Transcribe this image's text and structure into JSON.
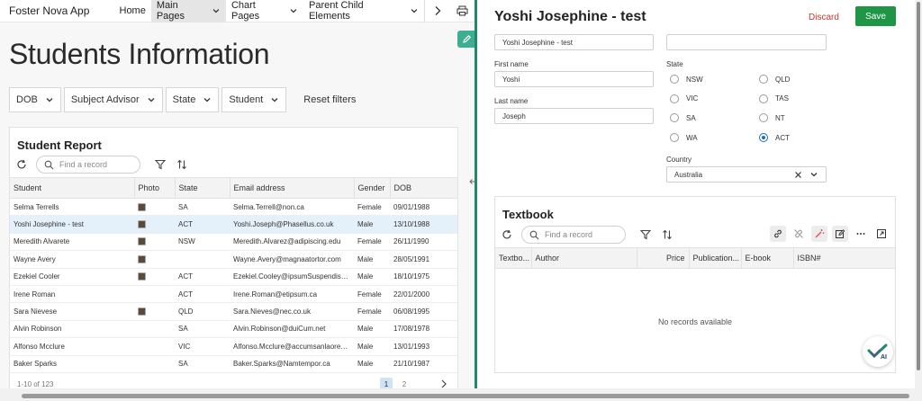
{
  "app": {
    "name": "Foster Nova App"
  },
  "nav": {
    "items": [
      {
        "label": "Home"
      },
      {
        "label": "Main Pages"
      },
      {
        "label": "Chart Pages"
      },
      {
        "label": "Parent Child Elements"
      }
    ]
  },
  "page": {
    "title": "Students Information"
  },
  "filters": {
    "items": [
      {
        "label": "DOB"
      },
      {
        "label": "Subject Advisor"
      },
      {
        "label": "State"
      },
      {
        "label": "Student"
      }
    ],
    "reset_label": "Reset filters"
  },
  "report": {
    "title": "Student Report",
    "search_placeholder": "Find a record",
    "columns": [
      "Student",
      "Photo",
      "State",
      "Email address",
      "Gender",
      "DOB"
    ],
    "rows": [
      {
        "student": "Selma Terrells",
        "photo": true,
        "state": "SA",
        "email": "Selma.Terrell@non.ca",
        "gender": "Female",
        "dob": "09/01/1988"
      },
      {
        "student": "Yoshi Josephine - test",
        "photo": true,
        "state": "ACT",
        "email": "Yoshi.Joseph@Phasellus.co.uk",
        "gender": "Male",
        "dob": "13/10/1988"
      },
      {
        "student": "Meredith Alvarete",
        "photo": true,
        "state": "NSW",
        "email": "Meredith.Alvarez@adipiscing.edu",
        "gender": "Female",
        "dob": "26/11/1990"
      },
      {
        "student": "Wayne Avery",
        "photo": true,
        "state": "",
        "email": "Wayne.Avery@magnaatortor.com",
        "gender": "Male",
        "dob": "28/05/1991"
      },
      {
        "student": "Ezekiel Cooler",
        "photo": true,
        "state": "ACT",
        "email": "Ezekiel.Cooley@ipsumSuspendissesa...",
        "gender": "Male",
        "dob": "18/10/1975"
      },
      {
        "student": "Irene Roman",
        "photo": false,
        "state": "ACT",
        "email": "Irene.Roman@etipsum.ca",
        "gender": "Female",
        "dob": "22/01/2000"
      },
      {
        "student": "Sara Nievese",
        "photo": true,
        "state": "QLD",
        "email": "Sara.Nieves@nec.co.uk",
        "gender": "Female",
        "dob": "06/08/1995"
      },
      {
        "student": "Alvin Robinson",
        "photo": false,
        "state": "SA",
        "email": "Alvin.Robinson@duiCum.net",
        "gender": "Male",
        "dob": "17/08/1978"
      },
      {
        "student": "Alfonso Mcclure",
        "photo": false,
        "state": "VIC",
        "email": "Alfonso.Mcclure@accumsanlaoreetip...",
        "gender": "Male",
        "dob": "13/01/1993"
      },
      {
        "student": "Baker Sparks",
        "photo": false,
        "state": "SA",
        "email": "Baker.Sparks@Namtempor.ca",
        "gender": "Male",
        "dob": "21/10/1987"
      }
    ],
    "pager": {
      "summary": "1-10 of 123",
      "pages": [
        "1",
        "2"
      ],
      "current": "1"
    }
  },
  "edit": {
    "title": "Yoshi Josephine - test",
    "discard_label": "Discard",
    "save_label": "Save",
    "top_field_value": "Yoshi Josephine - test",
    "top_field_right_value": "",
    "first_name_label": "First name",
    "first_name_value": "Yoshi",
    "last_name_label": "Last name",
    "last_name_value": "Joseph",
    "state_label": "State",
    "state_options": [
      {
        "label": "NSW",
        "checked": false
      },
      {
        "label": "QLD",
        "checked": false
      },
      {
        "label": "VIC",
        "checked": false
      },
      {
        "label": "TAS",
        "checked": false
      },
      {
        "label": "SA",
        "checked": false
      },
      {
        "label": "NT",
        "checked": false
      },
      {
        "label": "WA",
        "checked": false
      },
      {
        "label": "ACT",
        "checked": true
      }
    ],
    "country_label": "Country",
    "country_value": "Australia"
  },
  "textbook": {
    "title": "Textbook",
    "search_placeholder": "Find a record",
    "columns": [
      "Textbo...",
      "Author",
      "Price",
      "Publication...",
      "E-book",
      "ISBN#"
    ],
    "empty_message": "No records available"
  },
  "colors": {
    "accent": "#1e8a6d",
    "save": "#1e9646",
    "discard": "#c0392b",
    "selected_row": "#e4f1fb"
  },
  "icons": [
    "chevron-down-icon",
    "chevron-right-icon",
    "printer-icon",
    "pencil-icon",
    "refresh-icon",
    "search-icon",
    "filter-icon",
    "sort-icon",
    "link-icon",
    "unlink-icon",
    "magic-wand-icon",
    "edit-icon",
    "more-icon",
    "open-external-icon",
    "close-icon",
    "resize-icon",
    "ai-badge-icon"
  ]
}
